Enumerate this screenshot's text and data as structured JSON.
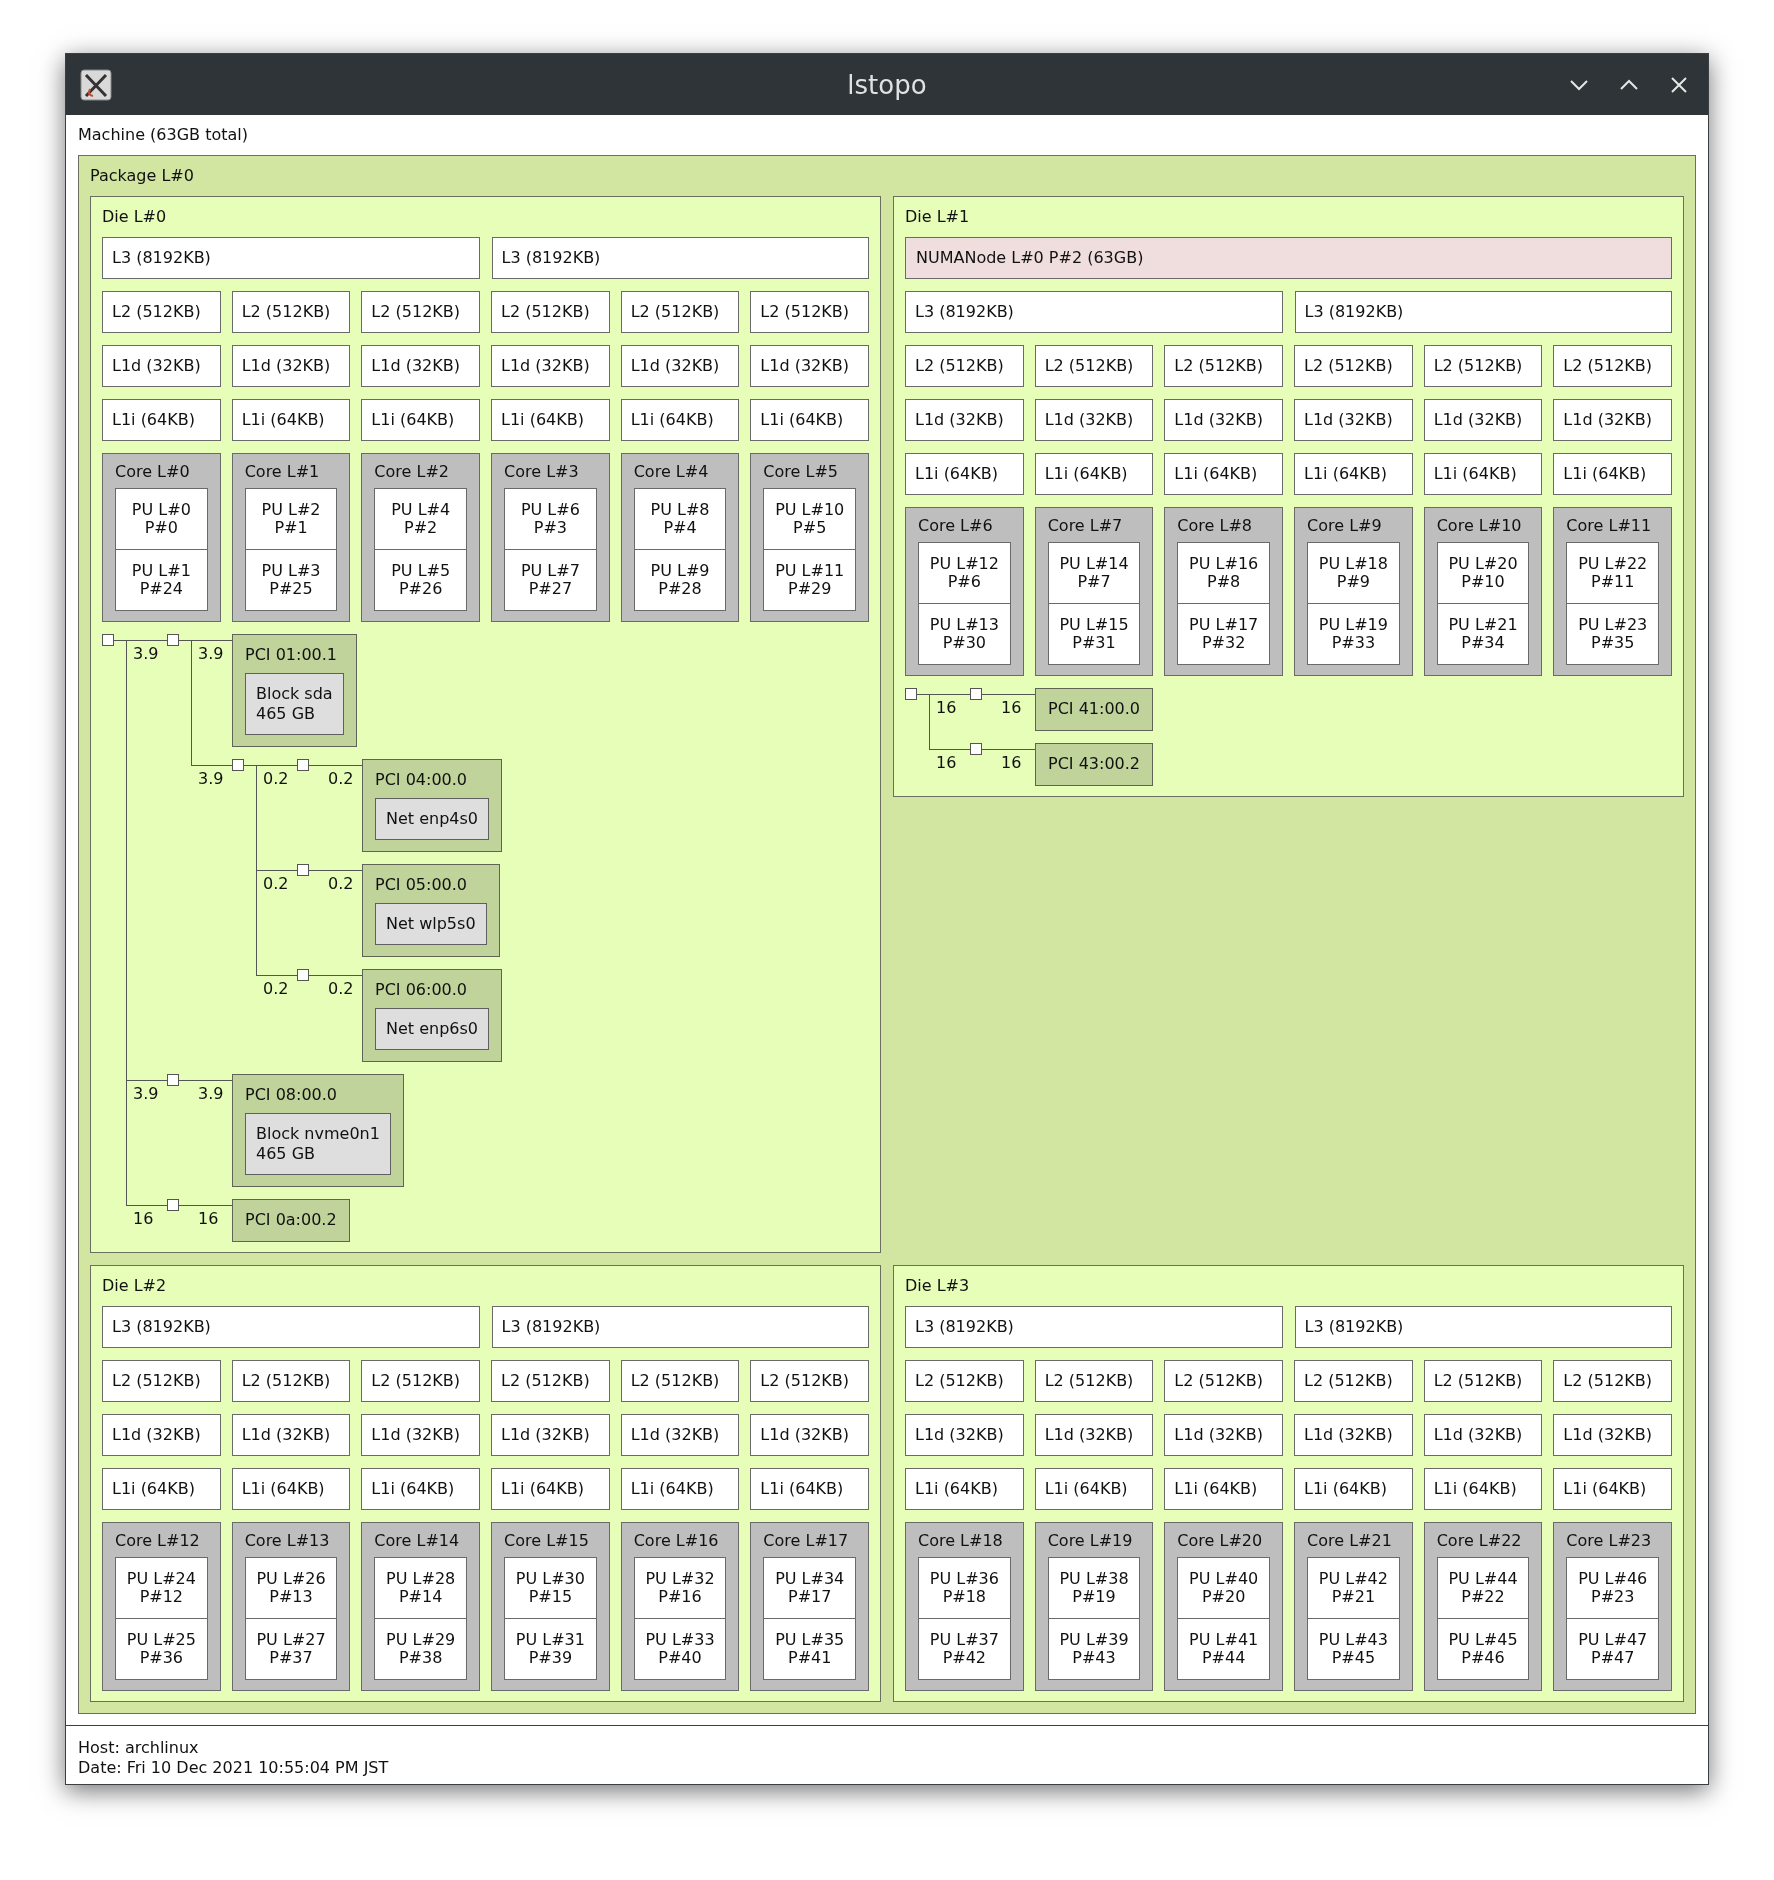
{
  "window": {
    "title": "lstopo"
  },
  "machine": {
    "label": "Machine (63GB total)"
  },
  "package": {
    "label": "Package L#0",
    "dies": [
      {
        "label": "Die L#0",
        "l3": [
          "L3 (8192KB)",
          "L3 (8192KB)"
        ],
        "l2": [
          "L2 (512KB)",
          "L2 (512KB)",
          "L2 (512KB)",
          "L2 (512KB)",
          "L2 (512KB)",
          "L2 (512KB)"
        ],
        "l1d": [
          "L1d (32KB)",
          "L1d (32KB)",
          "L1d (32KB)",
          "L1d (32KB)",
          "L1d (32KB)",
          "L1d (32KB)"
        ],
        "l1i": [
          "L1i (64KB)",
          "L1i (64KB)",
          "L1i (64KB)",
          "L1i (64KB)",
          "L1i (64KB)",
          "L1i (64KB)"
        ],
        "cores": [
          {
            "label": "Core L#0",
            "pus": [
              [
                "PU L#0",
                "P#0"
              ],
              [
                "PU L#1",
                "P#24"
              ]
            ]
          },
          {
            "label": "Core L#1",
            "pus": [
              [
                "PU L#2",
                "P#1"
              ],
              [
                "PU L#3",
                "P#25"
              ]
            ]
          },
          {
            "label": "Core L#2",
            "pus": [
              [
                "PU L#4",
                "P#2"
              ],
              [
                "PU L#5",
                "P#26"
              ]
            ]
          },
          {
            "label": "Core L#3",
            "pus": [
              [
                "PU L#6",
                "P#3"
              ],
              [
                "PU L#7",
                "P#27"
              ]
            ]
          },
          {
            "label": "Core L#4",
            "pus": [
              [
                "PU L#8",
                "P#4"
              ],
              [
                "PU L#9",
                "P#28"
              ]
            ]
          },
          {
            "label": "Core L#5",
            "pus": [
              [
                "PU L#10",
                "P#5"
              ],
              [
                "PU L#11",
                "P#29"
              ]
            ]
          }
        ],
        "pci": {
          "kind": "bridge",
          "children": [
            {
              "speed": "3.9",
              "target": {
                "kind": "bridge",
                "children": [
                  {
                    "speed": "3.9",
                    "target": {
                      "kind": "pci",
                      "label": "PCI 01:00.1",
                      "devices": [
                        [
                          "Block sda",
                          "465 GB"
                        ]
                      ]
                    }
                  },
                  {
                    "speed": "3.9",
                    "target": {
                      "kind": "bridge",
                      "children": [
                        {
                          "speed": "0.2",
                          "target": {
                            "kind": "bridge",
                            "children": [
                              {
                                "speed": "0.2",
                                "target": {
                                  "kind": "pci",
                                  "label": "PCI 04:00.0",
                                  "devices": [
                                    [
                                      "Net enp4s0"
                                    ]
                                  ]
                                }
                              }
                            ]
                          }
                        },
                        {
                          "speed": "0.2",
                          "target": {
                            "kind": "bridge",
                            "children": [
                              {
                                "speed": "0.2",
                                "target": {
                                  "kind": "pci",
                                  "label": "PCI 05:00.0",
                                  "devices": [
                                    [
                                      "Net wlp5s0"
                                    ]
                                  ]
                                }
                              }
                            ]
                          }
                        },
                        {
                          "speed": "0.2",
                          "target": {
                            "kind": "bridge",
                            "children": [
                              {
                                "speed": "0.2",
                                "target": {
                                  "kind": "pci",
                                  "label": "PCI 06:00.0",
                                  "devices": [
                                    [
                                      "Net enp6s0"
                                    ]
                                  ]
                                }
                              }
                            ]
                          }
                        }
                      ]
                    }
                  }
                ]
              }
            },
            {
              "speed": "3.9",
              "target": {
                "kind": "bridge",
                "children": [
                  {
                    "speed": "3.9",
                    "target": {
                      "kind": "pci",
                      "label": "PCI 08:00.0",
                      "devices": [
                        [
                          "Block nvme0n1",
                          "465 GB"
                        ]
                      ]
                    }
                  }
                ]
              }
            },
            {
              "speed": "16",
              "target": {
                "kind": "bridge",
                "children": [
                  {
                    "speed": "16",
                    "target": {
                      "kind": "pci",
                      "label": "PCI 0a:00.2"
                    }
                  }
                ]
              }
            }
          ]
        }
      },
      {
        "label": "Die L#1",
        "numa": "NUMANode L#0 P#2 (63GB)",
        "l3": [
          "L3 (8192KB)",
          "L3 (8192KB)"
        ],
        "l2": [
          "L2 (512KB)",
          "L2 (512KB)",
          "L2 (512KB)",
          "L2 (512KB)",
          "L2 (512KB)",
          "L2 (512KB)"
        ],
        "l1d": [
          "L1d (32KB)",
          "L1d (32KB)",
          "L1d (32KB)",
          "L1d (32KB)",
          "L1d (32KB)",
          "L1d (32KB)"
        ],
        "l1i": [
          "L1i (64KB)",
          "L1i (64KB)",
          "L1i (64KB)",
          "L1i (64KB)",
          "L1i (64KB)",
          "L1i (64KB)"
        ],
        "cores": [
          {
            "label": "Core L#6",
            "pus": [
              [
                "PU L#12",
                "P#6"
              ],
              [
                "PU L#13",
                "P#30"
              ]
            ]
          },
          {
            "label": "Core L#7",
            "pus": [
              [
                "PU L#14",
                "P#7"
              ],
              [
                "PU L#15",
                "P#31"
              ]
            ]
          },
          {
            "label": "Core L#8",
            "pus": [
              [
                "PU L#16",
                "P#8"
              ],
              [
                "PU L#17",
                "P#32"
              ]
            ]
          },
          {
            "label": "Core L#9",
            "pus": [
              [
                "PU L#18",
                "P#9"
              ],
              [
                "PU L#19",
                "P#33"
              ]
            ]
          },
          {
            "label": "Core L#10",
            "pus": [
              [
                "PU L#20",
                "P#10"
              ],
              [
                "PU L#21",
                "P#34"
              ]
            ]
          },
          {
            "label": "Core L#11",
            "pus": [
              [
                "PU L#22",
                "P#11"
              ],
              [
                "PU L#23",
                "P#35"
              ]
            ]
          }
        ],
        "pci": {
          "kind": "bridge",
          "children": [
            {
              "speed": "16",
              "target": {
                "kind": "bridge",
                "children": [
                  {
                    "speed": "16",
                    "target": {
                      "kind": "pci",
                      "label": "PCI 41:00.0"
                    }
                  }
                ]
              }
            },
            {
              "speed": "16",
              "target": {
                "kind": "bridge",
                "children": [
                  {
                    "speed": "16",
                    "target": {
                      "kind": "pci",
                      "label": "PCI 43:00.2"
                    }
                  }
                ]
              }
            }
          ]
        }
      },
      {
        "label": "Die L#2",
        "l3": [
          "L3 (8192KB)",
          "L3 (8192KB)"
        ],
        "l2": [
          "L2 (512KB)",
          "L2 (512KB)",
          "L2 (512KB)",
          "L2 (512KB)",
          "L2 (512KB)",
          "L2 (512KB)"
        ],
        "l1d": [
          "L1d (32KB)",
          "L1d (32KB)",
          "L1d (32KB)",
          "L1d (32KB)",
          "L1d (32KB)",
          "L1d (32KB)"
        ],
        "l1i": [
          "L1i (64KB)",
          "L1i (64KB)",
          "L1i (64KB)",
          "L1i (64KB)",
          "L1i (64KB)",
          "L1i (64KB)"
        ],
        "cores": [
          {
            "label": "Core L#12",
            "pus": [
              [
                "PU L#24",
                "P#12"
              ],
              [
                "PU L#25",
                "P#36"
              ]
            ]
          },
          {
            "label": "Core L#13",
            "pus": [
              [
                "PU L#26",
                "P#13"
              ],
              [
                "PU L#27",
                "P#37"
              ]
            ]
          },
          {
            "label": "Core L#14",
            "pus": [
              [
                "PU L#28",
                "P#14"
              ],
              [
                "PU L#29",
                "P#38"
              ]
            ]
          },
          {
            "label": "Core L#15",
            "pus": [
              [
                "PU L#30",
                "P#15"
              ],
              [
                "PU L#31",
                "P#39"
              ]
            ]
          },
          {
            "label": "Core L#16",
            "pus": [
              [
                "PU L#32",
                "P#16"
              ],
              [
                "PU L#33",
                "P#40"
              ]
            ]
          },
          {
            "label": "Core L#17",
            "pus": [
              [
                "PU L#34",
                "P#17"
              ],
              [
                "PU L#35",
                "P#41"
              ]
            ]
          }
        ]
      },
      {
        "label": "Die L#3",
        "l3": [
          "L3 (8192KB)",
          "L3 (8192KB)"
        ],
        "l2": [
          "L2 (512KB)",
          "L2 (512KB)",
          "L2 (512KB)",
          "L2 (512KB)",
          "L2 (512KB)",
          "L2 (512KB)"
        ],
        "l1d": [
          "L1d (32KB)",
          "L1d (32KB)",
          "L1d (32KB)",
          "L1d (32KB)",
          "L1d (32KB)",
          "L1d (32KB)"
        ],
        "l1i": [
          "L1i (64KB)",
          "L1i (64KB)",
          "L1i (64KB)",
          "L1i (64KB)",
          "L1i (64KB)",
          "L1i (64KB)"
        ],
        "cores": [
          {
            "label": "Core L#18",
            "pus": [
              [
                "PU L#36",
                "P#18"
              ],
              [
                "PU L#37",
                "P#42"
              ]
            ]
          },
          {
            "label": "Core L#19",
            "pus": [
              [
                "PU L#38",
                "P#19"
              ],
              [
                "PU L#39",
                "P#43"
              ]
            ]
          },
          {
            "label": "Core L#20",
            "pus": [
              [
                "PU L#40",
                "P#20"
              ],
              [
                "PU L#41",
                "P#44"
              ]
            ]
          },
          {
            "label": "Core L#21",
            "pus": [
              [
                "PU L#42",
                "P#21"
              ],
              [
                "PU L#43",
                "P#45"
              ]
            ]
          },
          {
            "label": "Core L#22",
            "pus": [
              [
                "PU L#44",
                "P#22"
              ],
              [
                "PU L#45",
                "P#46"
              ]
            ]
          },
          {
            "label": "Core L#23",
            "pus": [
              [
                "PU L#46",
                "P#23"
              ],
              [
                "PU L#47",
                "P#47"
              ]
            ]
          }
        ]
      }
    ]
  },
  "footer": [
    "Host: archlinux",
    "Date: Fri 10 Dec 2021 10:55:04 PM JST"
  ]
}
